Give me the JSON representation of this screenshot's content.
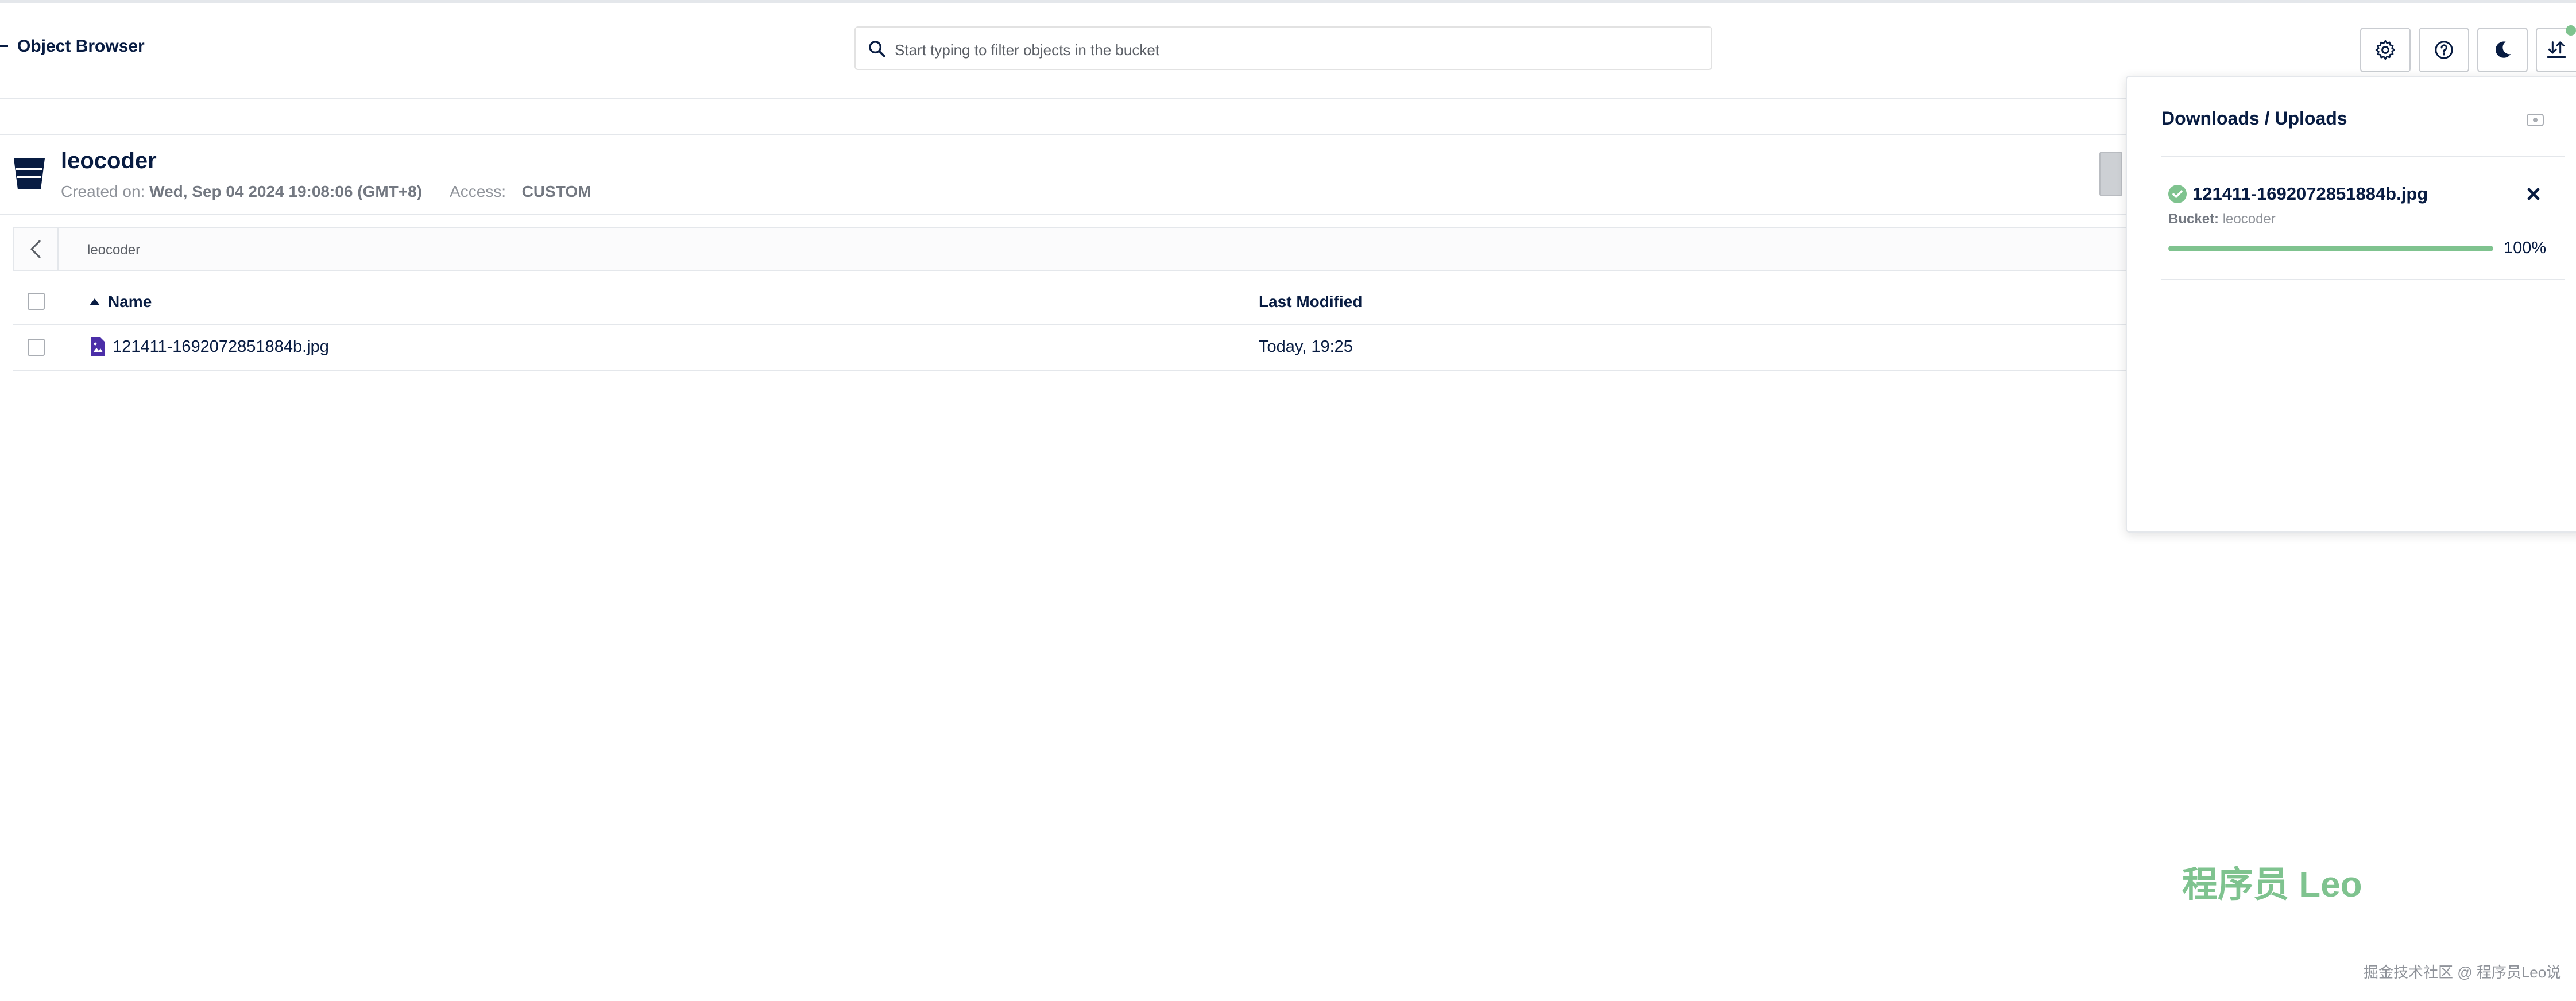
{
  "header": {
    "title": "Object Browser",
    "search_placeholder": "Start typing to filter objects in the bucket",
    "buttons": [
      {
        "name": "settings-button",
        "icon": "gear-icon"
      },
      {
        "name": "help-button",
        "icon": "help-icon"
      },
      {
        "name": "dark-mode-button",
        "icon": "moon-icon"
      },
      {
        "name": "downloads-uploads-button",
        "icon": "download-upload-icon"
      }
    ]
  },
  "bucket": {
    "name": "leocoder",
    "created_label": "Created on:",
    "created_value": "Wed, Sep 04 2024 19:08:06 (GMT+8)",
    "access_label": "Access:",
    "access_value": "CUSTOM"
  },
  "breadcrumb": {
    "path": "leocoder"
  },
  "table": {
    "columns": [
      "Name",
      "Last Modified"
    ],
    "sort_column": "Name",
    "sort_direction": "ascending",
    "rows": [
      {
        "name": "121411-1692072851884b.jpg",
        "last_modified": "Today, 19:25",
        "icon": "image-file-icon"
      }
    ]
  },
  "downloads_panel": {
    "title": "Downloads / Uploads",
    "item": {
      "file_name": "121411-1692072851884b.jpg",
      "bucket_label": "Bucket:",
      "bucket_value": "leocoder",
      "progress": 100,
      "progress_text": "100%",
      "status": "completed"
    }
  },
  "watermark": {
    "main": "程序员 Leo",
    "footer": "掘金技术社区 @ 程序员Leo说"
  },
  "colors": {
    "primary_text": "#081c42",
    "success_green": "#7fc38f",
    "file_icon": "#4b2ea8",
    "muted_text": "#8f939a"
  }
}
